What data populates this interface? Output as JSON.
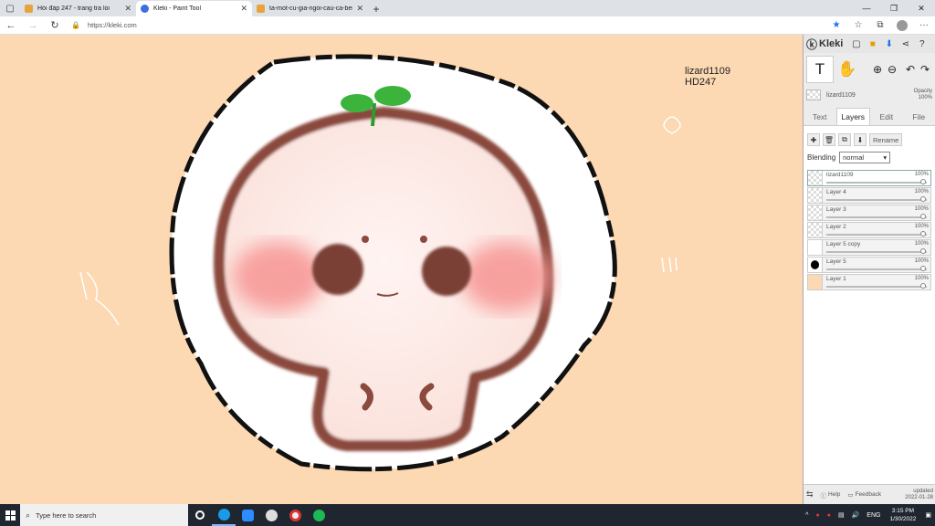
{
  "browser": {
    "tabs": [
      {
        "title": "Hỏi đáp 247 - trang tra loi",
        "favicon_color": "#e8a33d"
      },
      {
        "title": "Kleki - Paint Tool",
        "favicon_color": "#3b6fe0"
      },
      {
        "title": "ta-mot-cu-gia-ngoi-cau-ca-ben",
        "favicon_color": "#e8a33d"
      }
    ],
    "url": "https://kleki.com"
  },
  "canvas": {
    "bg_color": "#fcd8b3",
    "signature_line1": "lizard1109",
    "signature_line2": "HD247"
  },
  "panel": {
    "logo_text": "Kleki",
    "brush_layer_name": "lizard1109",
    "opacity_label": "Opacity",
    "opacity_value": "100%",
    "tabs": [
      "Text",
      "Layers",
      "Edit",
      "File"
    ],
    "active_tab": "Layers",
    "rename_label": "Rename",
    "blending_label": "Blending",
    "blending_value": "normal",
    "layers": [
      {
        "name": "lizard1109",
        "opacity": "100%"
      },
      {
        "name": "Layer 4",
        "opacity": "100%"
      },
      {
        "name": "Layer 3",
        "opacity": "100%"
      },
      {
        "name": "Layer 2",
        "opacity": "100%"
      },
      {
        "name": "Layer 5 copy",
        "opacity": "100%"
      },
      {
        "name": "Layer 5",
        "opacity": "100%"
      },
      {
        "name": "Layer 1",
        "opacity": "100%"
      }
    ],
    "help_label": "Help",
    "feedback_label": "Feedback",
    "updated_label": "updated",
    "updated_date": "2022-01-28"
  },
  "taskbar": {
    "search_placeholder": "Type here to search",
    "lang": "ENG",
    "time": "3:15 PM",
    "date": "1/30/2022"
  }
}
